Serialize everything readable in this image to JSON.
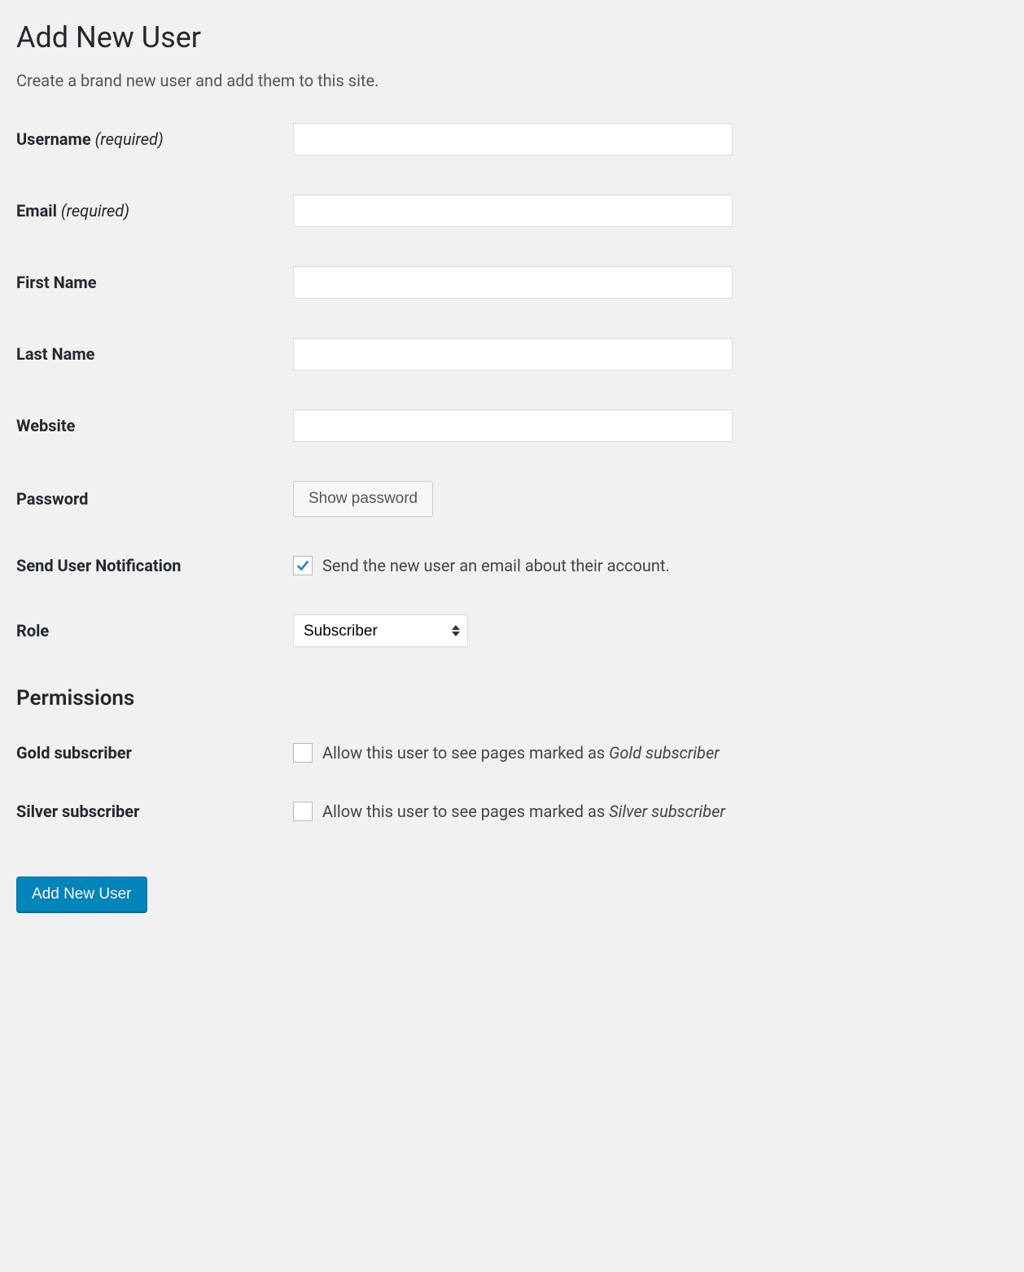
{
  "page": {
    "title": "Add New User",
    "subtitle": "Create a brand new user and add them to this site."
  },
  "fields": {
    "username": {
      "label": "Username",
      "required": "(required)",
      "value": ""
    },
    "email": {
      "label": "Email",
      "required": "(required)",
      "value": ""
    },
    "firstname": {
      "label": "First Name",
      "value": ""
    },
    "lastname": {
      "label": "Last Name",
      "value": ""
    },
    "website": {
      "label": "Website",
      "value": ""
    },
    "password": {
      "label": "Password",
      "button": "Show password"
    },
    "notification": {
      "label": "Send User Notification",
      "checkbox_label": "Send the new user an email about their account.",
      "checked": true
    },
    "role": {
      "label": "Role",
      "selected": "Subscriber"
    }
  },
  "permissions": {
    "heading": "Permissions",
    "gold": {
      "label": "Gold subscriber",
      "desc_prefix": "Allow this user to see pages marked as ",
      "desc_em": "Gold subscriber",
      "checked": false
    },
    "silver": {
      "label": "Silver subscriber",
      "desc_prefix": "Allow this user to see pages marked as ",
      "desc_em": "Silver subscriber",
      "checked": false
    }
  },
  "submit": {
    "label": "Add New User"
  }
}
